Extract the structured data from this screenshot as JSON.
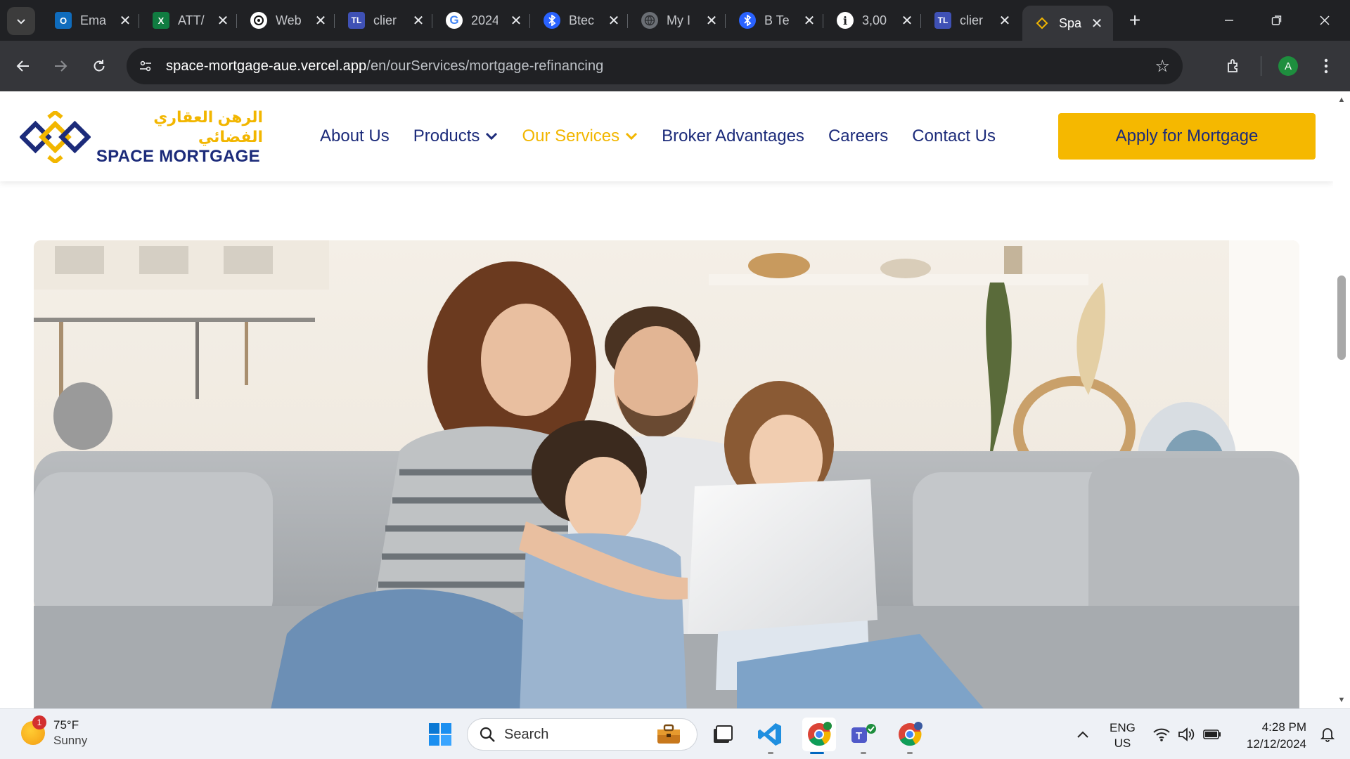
{
  "browser": {
    "tabs": [
      {
        "label": "Ema",
        "icon": "outlook-icon",
        "color": "#0f6cbd",
        "glyph": "O"
      },
      {
        "label": "ATT/",
        "icon": "excel-icon",
        "color": "#107c41",
        "glyph": "X"
      },
      {
        "label": "Web",
        "icon": "chatgpt-icon",
        "color": "#ffffff",
        "glyph": ""
      },
      {
        "label": "clier",
        "icon": "tl-icon",
        "color": "#3f51b5",
        "glyph": "TL"
      },
      {
        "label": "2024",
        "icon": "google-icon",
        "color": "#ffffff",
        "glyph": "G"
      },
      {
        "label": "Btec",
        "icon": "bluetooth-app-icon",
        "color": "#2962ff",
        "glyph": ""
      },
      {
        "label": "My I",
        "icon": "globe-icon",
        "color": "#6b6f75",
        "glyph": ""
      },
      {
        "label": "B Te",
        "icon": "bluetooth-app-icon",
        "color": "#2962ff",
        "glyph": ""
      },
      {
        "label": "3,00",
        "icon": "info-icon",
        "color": "#ffffff",
        "glyph": "i"
      },
      {
        "label": "clier",
        "icon": "tl-icon",
        "color": "#3f51b5",
        "glyph": "TL"
      },
      {
        "label": "Spa",
        "icon": "space-mortgage-icon",
        "color": "#f2b600",
        "glyph": ""
      }
    ],
    "url_host": "space-mortgage-aue.vercel.app",
    "url_path": "/en/ourServices/mortgage-refinancing",
    "profile_initial": "A"
  },
  "site": {
    "logo_arabic": "الرهن العقاري الفضائي",
    "logo_english": "SPACE MORTGAGE",
    "nav": {
      "about": "About Us",
      "products": "Products",
      "services": "Our Services",
      "broker": "Broker Advantages",
      "careers": "Careers",
      "contact": "Contact Us"
    },
    "apply_button": "Apply for Mortgage",
    "colors": {
      "brand_navy": "#1c2b7a",
      "brand_yellow": "#f5b800"
    }
  },
  "taskbar": {
    "weather_temp": "75°F",
    "weather_condition": "Sunny",
    "weather_badge": "1",
    "search_placeholder": "Search",
    "lang_primary": "ENG",
    "lang_secondary": "US",
    "time": "4:28 PM",
    "date": "12/12/2024"
  }
}
